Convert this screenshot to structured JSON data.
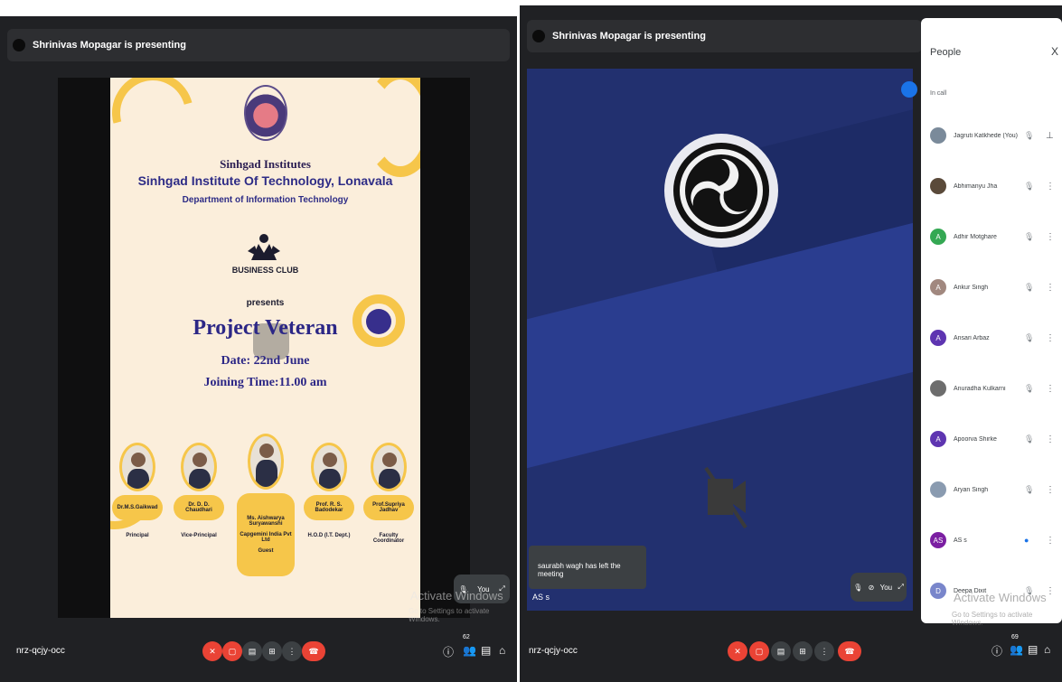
{
  "left": {
    "presenting": "Shrinivas Mopagar is presenting",
    "poster": {
      "institutes": "Sinhgad Institutes",
      "college": "Sinhgad Institute Of Technology, Lonavala",
      "department": "Department of Information Technology",
      "club": "BUSINESS CLUB",
      "presents": "presents",
      "event": "Project Veteran",
      "date": "Date: 22nd  June",
      "time": "Joining Time:11.00 am",
      "speakers": [
        {
          "name": "Dr.M.S.Gaikwad",
          "role": "Principal"
        },
        {
          "name": "Dr. D. D. Chaudhari",
          "role": "Vice-Principal"
        },
        {
          "name": "Ms. Aishwarya Suryawanshi",
          "company": "Capgemini India Pvt Ltd",
          "role": "Guest"
        },
        {
          "name": "Prof. R. S. Badodekar",
          "role": "H.O.D (I.T. Dept.)"
        },
        {
          "name": "Prof.Supriya Jadhav",
          "role": "Faculty Coordinator"
        }
      ]
    },
    "self_label": "You",
    "watermark": "Activate Windows",
    "watermark_sub": "Go to Settings to activate Windows.",
    "meeting_code": "nrz-qcjy-occ",
    "participants_count": "62"
  },
  "right": {
    "presenting": "Shrinivas Mopagar is presenting",
    "toast": "saurabh wagh has left the meeting",
    "tile_name": "AS s",
    "self_label": "You",
    "watermark": "Activate Windows",
    "watermark_sub": "Go to Settings to activate Windows.",
    "meeting_code": "nrz-qcjy-occ",
    "participants_count": "69",
    "people": {
      "title": "People",
      "close": "X",
      "section": "In call",
      "members": [
        {
          "name": "Jagruti Katkhede (You)",
          "initial": "",
          "color": "#7a8a9a"
        },
        {
          "name": "Abhimanyu Jha",
          "initial": "",
          "color": "#5a4a3a"
        },
        {
          "name": "Adhir Motghare",
          "initial": "A",
          "color": "#34a853"
        },
        {
          "name": "Ankur Singh",
          "initial": "A",
          "color": "#a1887f"
        },
        {
          "name": "Ansari Arbaz",
          "initial": "A",
          "color": "#5e35b1"
        },
        {
          "name": "Anuradha Kulkarni",
          "initial": "",
          "color": "#6d6d6d"
        },
        {
          "name": "Apoorva Shirke",
          "initial": "A",
          "color": "#5e35b1"
        },
        {
          "name": "Aryan Singh",
          "initial": "",
          "color": "#8a9bb0"
        },
        {
          "name": "AS s",
          "initial": "AS",
          "color": "#7b1fa2"
        },
        {
          "name": "Deepa Dixit",
          "initial": "D",
          "color": "#7986cb"
        }
      ]
    }
  }
}
